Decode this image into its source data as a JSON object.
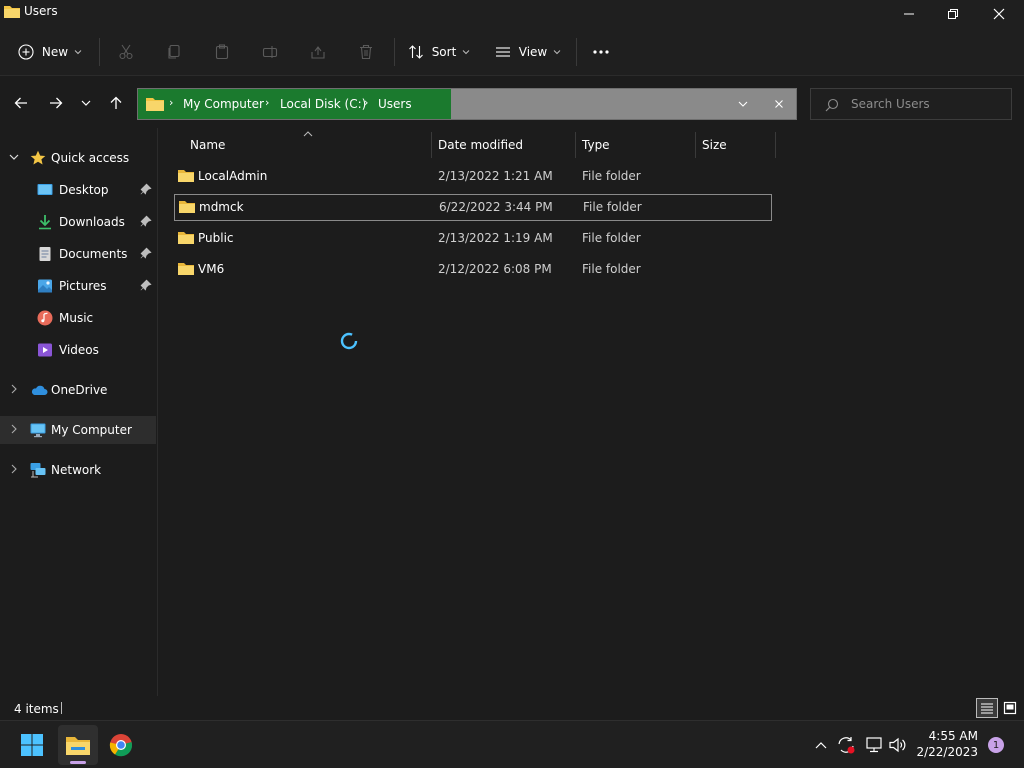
{
  "window": {
    "title": "Users"
  },
  "toolbar": {
    "new_label": "New",
    "sort_label": "Sort",
    "view_label": "View",
    "more_label": "···"
  },
  "address": {
    "crumbs": [
      "My Computer",
      "Local Disk (C:)",
      "Users"
    ],
    "search_placeholder": "Search Users"
  },
  "nav": {
    "quick_access": "Quick access",
    "items": [
      {
        "label": "Desktop",
        "icon": "desktop-icon",
        "pinned": true
      },
      {
        "label": "Downloads",
        "icon": "downloads-icon",
        "pinned": true
      },
      {
        "label": "Documents",
        "icon": "documents-icon",
        "pinned": true
      },
      {
        "label": "Pictures",
        "icon": "pictures-icon",
        "pinned": true
      },
      {
        "label": "Music",
        "icon": "music-icon",
        "pinned": false
      },
      {
        "label": "Videos",
        "icon": "videos-icon",
        "pinned": false
      }
    ],
    "onedrive": "OneDrive",
    "my_computer": "My Computer",
    "network": "Network"
  },
  "columns": {
    "name": "Name",
    "date": "Date modified",
    "type": "Type",
    "size": "Size"
  },
  "files": [
    {
      "name": "LocalAdmin",
      "date": "2/13/2022 1:21 AM",
      "type": "File folder"
    },
    {
      "name": "mdmck",
      "date": "6/22/2022 3:44 PM",
      "type": "File folder"
    },
    {
      "name": "Public",
      "date": "2/13/2022 1:19 AM",
      "type": "File folder"
    },
    {
      "name": "VM6",
      "date": "2/12/2022 6:08 PM",
      "type": "File folder"
    }
  ],
  "status": {
    "items_count": "4 items"
  },
  "taskbar": {
    "time": "4:55 AM",
    "date": "2/22/2023",
    "notification_count": "1"
  },
  "colors": {
    "address_highlight": "#1b7a2e",
    "folder": "#f3c545",
    "accent": "#4cc2ff"
  }
}
